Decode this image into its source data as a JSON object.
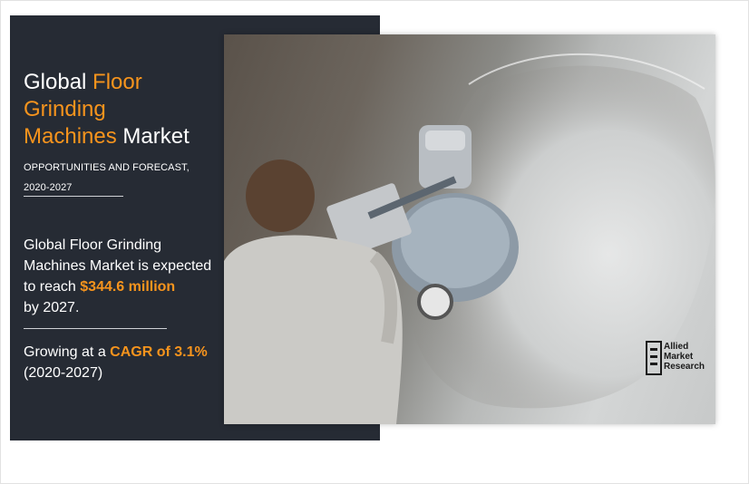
{
  "infographic": {
    "title_prefix": "Global",
    "title_highlight_1": "Floor",
    "title_highlight_2": "Grinding",
    "title_highlight_3": "Machines",
    "title_suffix": "Market",
    "subtitle_line1": "OPPORTUNITIES AND FORECAST,",
    "subtitle_line2": "2020-2027",
    "stat_line1": "Global Floor Grinding",
    "stat_line2": "Machines Market is expected",
    "stat_line3_prefix": "to reach",
    "stat_value": "$344.6 million",
    "stat_line4": "by 2027.",
    "cagr_prefix": "Growing at a",
    "cagr_value": "CAGR of 3.1%",
    "cagr_period": "(2020-2027)"
  },
  "logo": {
    "line1": "Allied",
    "line2": "Market",
    "line3": "Research"
  },
  "colors": {
    "panel": "#262b34",
    "accent": "#f7941d",
    "text": "#ffffff"
  }
}
